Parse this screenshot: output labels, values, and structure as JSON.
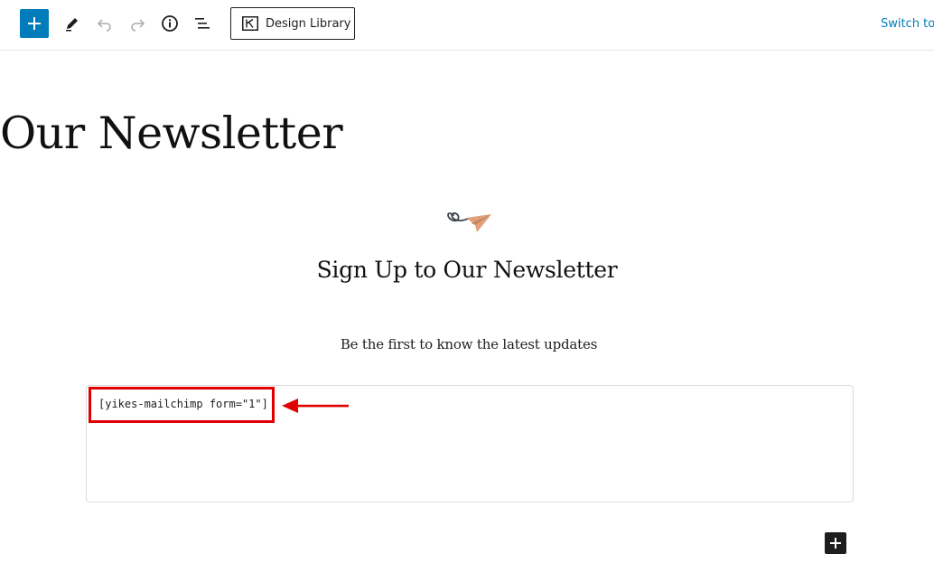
{
  "toolbar": {
    "add_block_icon": "plus-icon",
    "edit_icon": "pencil-icon",
    "undo_icon": "undo-icon",
    "redo_icon": "redo-icon",
    "info_icon": "info-icon",
    "list_view_icon": "list-view-icon",
    "design_library_label": "Design Library",
    "design_library_icon": "kadence-icon",
    "switch_link": "Switch to d"
  },
  "content": {
    "page_title": "Our Newsletter",
    "illustration_icon": "paper-plane-icon",
    "signup_heading": "Sign Up to Our Newsletter",
    "subtitle": "Be the first to know the latest updates",
    "shortcode": "[yikes-mailchimp form=\"1\"]",
    "annotation_color": "#e00000",
    "block_add_icon": "plus-icon"
  },
  "colors": {
    "accent": "#007cba",
    "annotation": "#e00000",
    "text": "#1e1e1e",
    "plane": "#e0a07a"
  }
}
